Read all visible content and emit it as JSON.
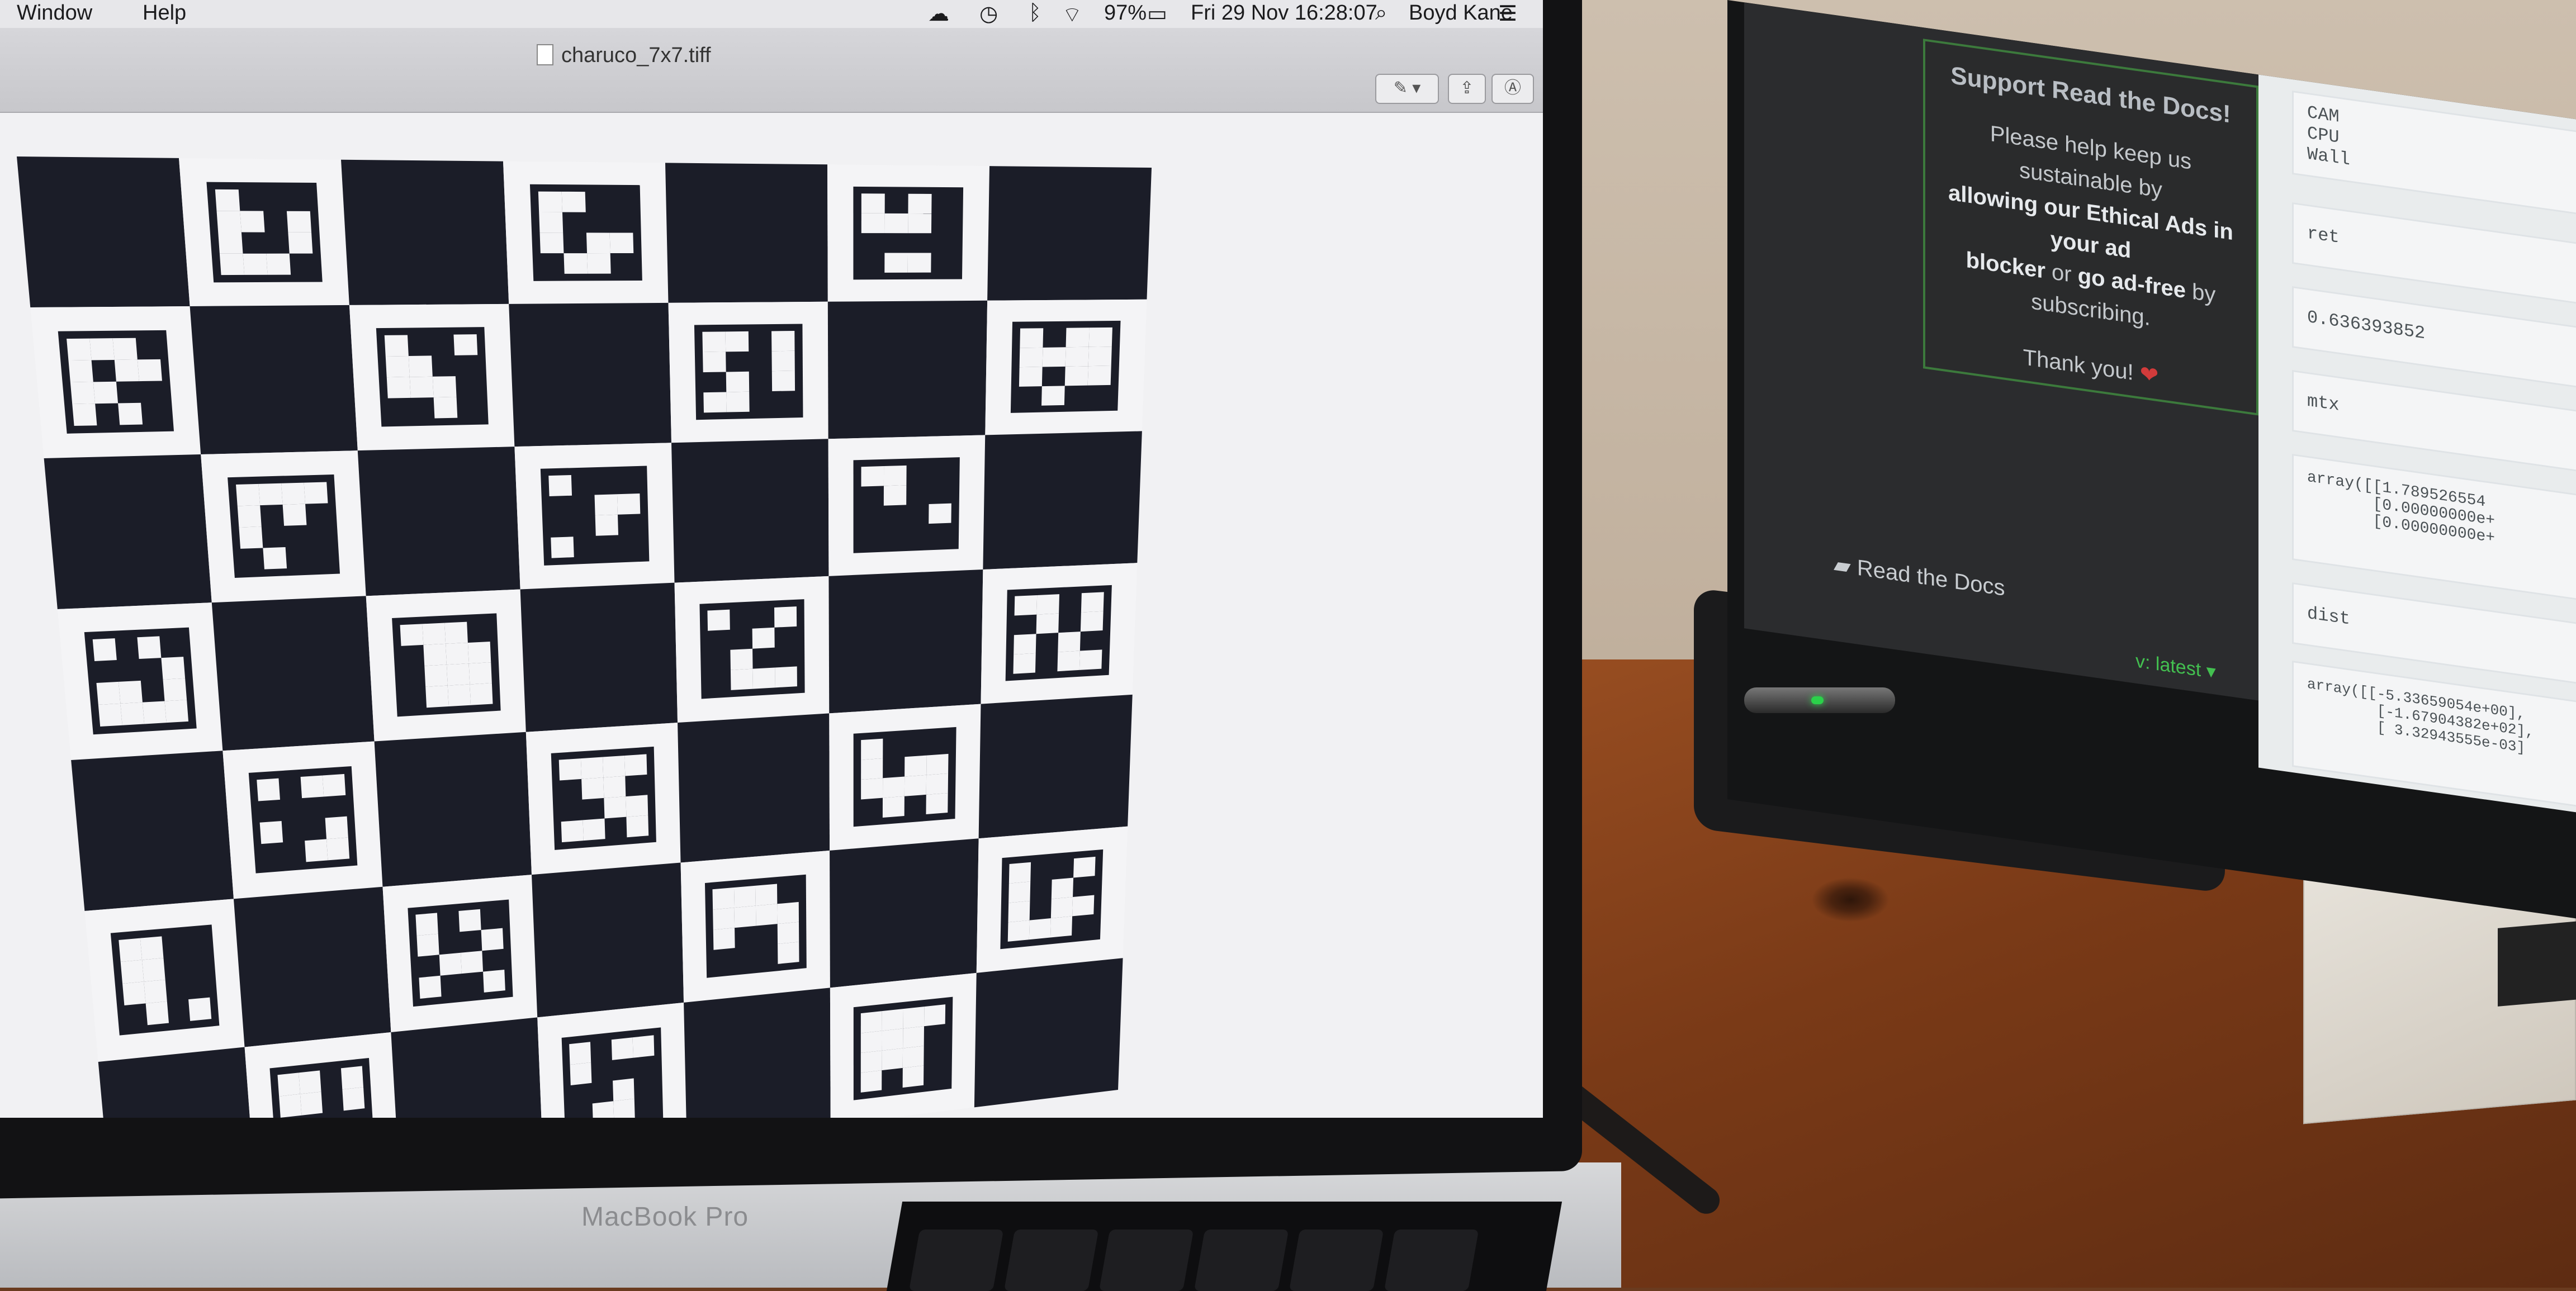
{
  "menubar": {
    "items": [
      "Window",
      "Help"
    ],
    "status": {
      "battery": "97%",
      "datetime": "Fri 29 Nov  16:28:07",
      "user": "Boyd Kane"
    }
  },
  "window": {
    "filename": "charuco_7x7.tiff"
  },
  "laptop": {
    "model_label": "MacBook Pro"
  },
  "monitor": {
    "ad": {
      "title": "Support Read the Docs!",
      "body_1": "Please help keep us sustainable by",
      "body_bold_1": "allowing our Ethical Ads in your ad",
      "body_bold_2": "blocker",
      "body_2": " or ",
      "body_bold_3": "go ad-free",
      "body_3": " by subscribing.",
      "thanks": "Thank you!"
    },
    "brand": "Read the Docs",
    "version": "v: latest",
    "cells": [
      "CAM\nCPU\nWall",
      "ret",
      "0.636393852",
      "mtx",
      "array([[1.789526554\n       [0.00000000e+\n       [0.00000000e+",
      "dist",
      "array([[-5.33659054e+00],\n        [-1.67904382e+02],\n        [ 3.32943555e-03]"
    ]
  },
  "colors": {
    "board_dark": "#1b1d28",
    "board_light": "#f4f4f6",
    "ad_border": "#3c7a3c",
    "version_green": "#43c050"
  }
}
